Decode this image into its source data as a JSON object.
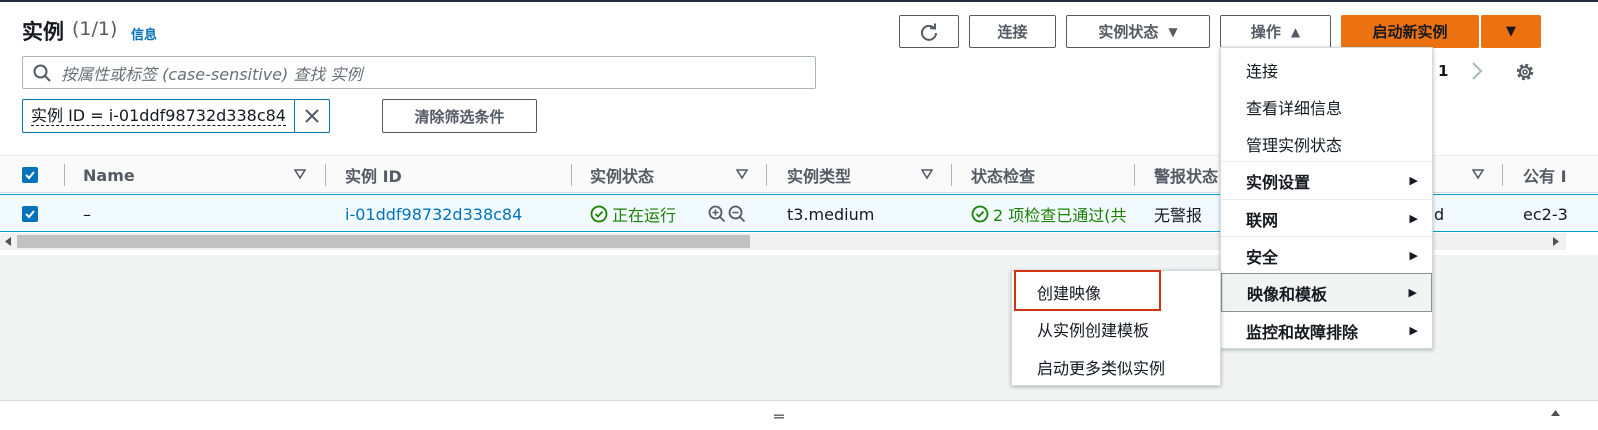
{
  "header": {
    "title": "实例",
    "count": "(1/1)",
    "info": "信息"
  },
  "toolbar": {
    "refresh_icon": "refresh-icon",
    "connect": "连接",
    "instance_state": "实例状态",
    "actions": "操作",
    "launch": "启动新实例"
  },
  "search": {
    "placeholder": "按属性或标签 (case-sensitive) 查找 实例"
  },
  "filter": {
    "token": "实例 ID = i-01ddf98732d338c84",
    "clear": "清除筛选条件"
  },
  "pagination": {
    "page": "1"
  },
  "table": {
    "columns": [
      "Name",
      "实例 ID",
      "实例状态",
      "实例类型",
      "状态检查",
      "警报状态",
      "公有 I"
    ],
    "row": {
      "name": "–",
      "instance_id": "i-01ddf98732d338c84",
      "state": "正在运行",
      "type": "t3.medium",
      "status_check": "2 项检查已通过(共",
      "alarm": "无警报",
      "az_tail": "d",
      "public_dns": "ec2-3"
    }
  },
  "actions_menu": {
    "items": [
      {
        "label": "连接",
        "bold": false
      },
      {
        "label": "查看详细信息",
        "bold": false
      },
      {
        "label": "管理实例状态",
        "bold": false
      },
      {
        "label": "实例设置",
        "bold": true
      },
      {
        "label": "联网",
        "bold": true
      },
      {
        "label": "安全",
        "bold": true
      },
      {
        "label": "映像和模板",
        "bold": true
      },
      {
        "label": "监控和故障排除",
        "bold": true
      }
    ]
  },
  "submenu": {
    "items": [
      "创建映像",
      "从实例创建模板",
      "启动更多类似实例"
    ]
  },
  "colors": {
    "primary": "#ec7211",
    "link": "#0073bb",
    "success": "#1d8102",
    "highlight": "#d13212"
  }
}
